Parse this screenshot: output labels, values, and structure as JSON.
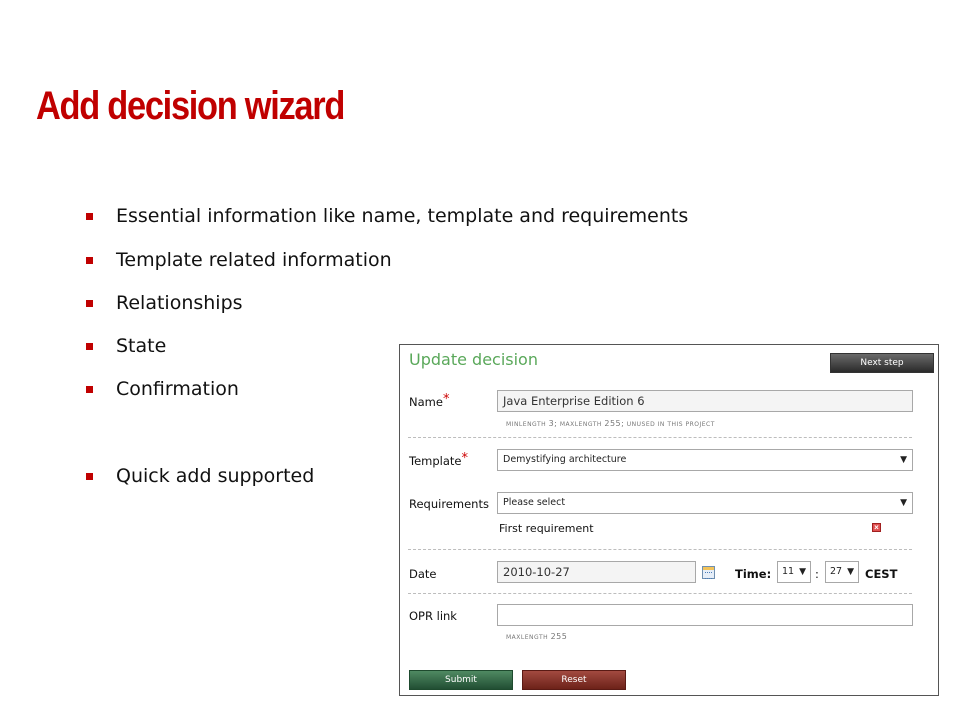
{
  "slide": {
    "title": "Add decision wizard",
    "bullets": [
      "Essential information like name, template and requirements",
      "Template related information",
      "Relationships",
      "State",
      "Confirmation",
      "Quick add supported"
    ]
  },
  "panel": {
    "title": "Update decision",
    "next_step_label": "Next step",
    "name": {
      "label": "Name",
      "required_mark": "*",
      "value": "Java Enterprise Edition 6",
      "hint_minlength_label": "minlength",
      "hint_minlength_value": "3;",
      "hint_maxlength_label": "maxlength",
      "hint_maxlength_value": "255;",
      "hint_unused": "unused in this project"
    },
    "template": {
      "label": "Template",
      "required_mark": "*",
      "selected": "Demystifying architecture"
    },
    "requirements": {
      "label": "Requirements",
      "selected": "Please select",
      "items": [
        "First requirement"
      ]
    },
    "date": {
      "label": "Date",
      "value": "2010-10-27",
      "time_label": "Time:",
      "hour": "11",
      "minute": "27",
      "separator": ":",
      "timezone": "CEST"
    },
    "opr_link": {
      "label": "OPR link",
      "value": "",
      "hint_maxlength_label": "maxlength",
      "hint_maxlength_value": "255"
    },
    "submit_label": "Submit",
    "reset_label": "Reset"
  },
  "icons": {
    "bullet": "square-bullet-icon",
    "calendar": "calendar-icon",
    "remove": "remove-icon",
    "dropdown": "chevron-down-icon"
  },
  "colors": {
    "title": "#c00000",
    "bullet": "#c00000",
    "panel_title": "#5aa85a",
    "submit": "#2f6a45",
    "reset": "#8a3228",
    "next_step": "#3a3a3a"
  }
}
